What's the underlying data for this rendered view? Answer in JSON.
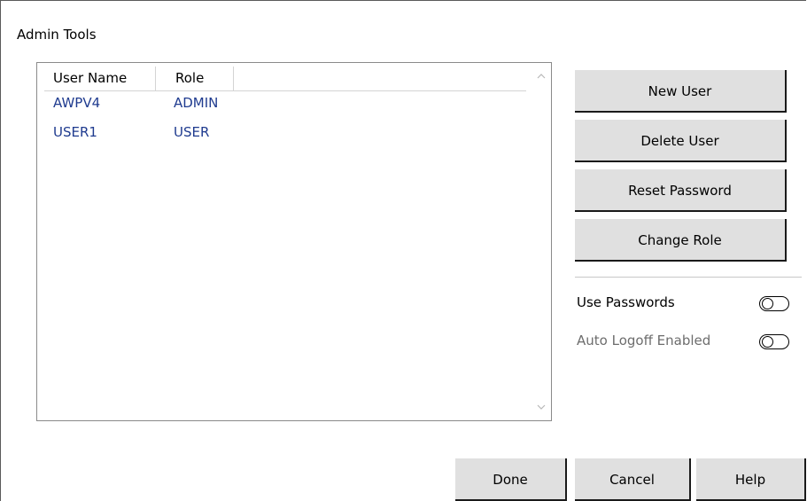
{
  "window": {
    "title": "Admin Tools"
  },
  "user_list": {
    "columns": [
      "User Name",
      "Role"
    ],
    "rows": [
      {
        "user_name": "AWPV4",
        "role": "ADMIN"
      },
      {
        "user_name": "USER1",
        "role": "USER"
      }
    ]
  },
  "actions": {
    "new_user": "New User",
    "delete_user": "Delete User",
    "reset_password": "Reset Password",
    "change_role": "Change Role"
  },
  "options": {
    "use_passwords": {
      "label": "Use Passwords",
      "enabled": false
    },
    "auto_logoff": {
      "label": "Auto Logoff Enabled",
      "enabled": false
    }
  },
  "footer": {
    "done": "Done",
    "cancel": "Cancel",
    "help": "Help"
  },
  "colors": {
    "row_text": "#1f3b8f",
    "button_bg": "#e0e0e0"
  }
}
